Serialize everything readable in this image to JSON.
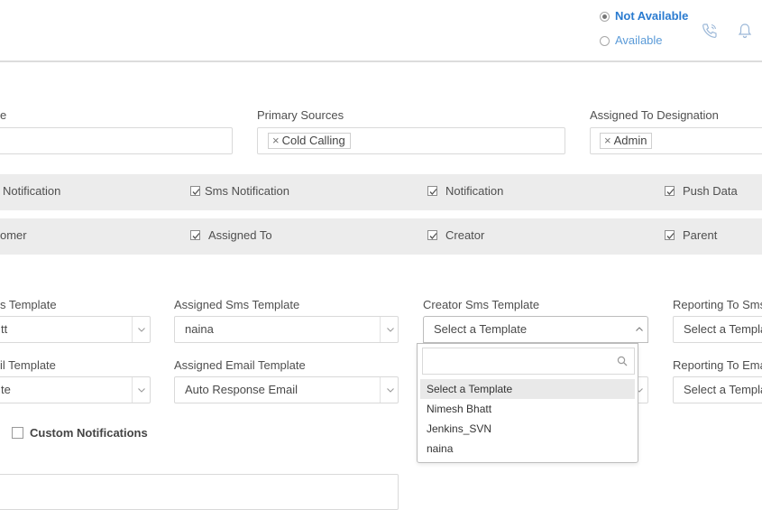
{
  "header": {
    "status_options": [
      {
        "label": "Not Available",
        "selected": true
      },
      {
        "label": "Available",
        "selected": false
      }
    ],
    "icons": [
      "phone-icon",
      "bell-icon"
    ]
  },
  "fields_row": {
    "partial_label": "e",
    "primary_sources_label": "Primary Sources",
    "primary_sources_tags": [
      "Cold Calling"
    ],
    "assigned_designation_label": "Assigned To Designation",
    "assigned_designation_tags": [
      "Admin"
    ]
  },
  "notification_band": {
    "items": [
      {
        "label": "Notification",
        "checked": null
      },
      {
        "label": "Sms Notification",
        "checked": true
      },
      {
        "label": "Notification",
        "checked": true
      },
      {
        "label": "Push Data",
        "checked": true
      }
    ]
  },
  "recipient_band": {
    "items": [
      {
        "label": "omer",
        "checked": null
      },
      {
        "label": "Assigned To",
        "checked": true
      },
      {
        "label": "Creator",
        "checked": true
      },
      {
        "label": "Parent",
        "checked": true
      }
    ]
  },
  "sms_templates": {
    "col1_label": "s Template",
    "col1_value": "tt",
    "col2_label": "Assigned Sms Template",
    "col2_value": "naina",
    "col3_label": "Creator Sms Template",
    "col3_value": "Select a Template",
    "col4_label": "Reporting To Sms",
    "col4_value": "Select a Templa"
  },
  "email_templates": {
    "col1_label": "il Template",
    "col1_value": "te",
    "col2_label": "Assigned Email Template",
    "col2_value": "Auto Response Email",
    "col4_label": "Reporting To Ema",
    "col4_value": "Select a Templa"
  },
  "dropdown": {
    "search_value": "",
    "options": [
      {
        "label": "Select a Template",
        "highlighted": true
      },
      {
        "label": "Nimesh Bhatt",
        "highlighted": false
      },
      {
        "label": "Jenkins_SVN",
        "highlighted": false
      },
      {
        "label": "naina",
        "highlighted": false
      }
    ]
  },
  "custom_notifications": {
    "label": "Custom Notifications",
    "checked": false
  },
  "colors": {
    "accent": "#2a7bd0",
    "band": "#ececec"
  }
}
